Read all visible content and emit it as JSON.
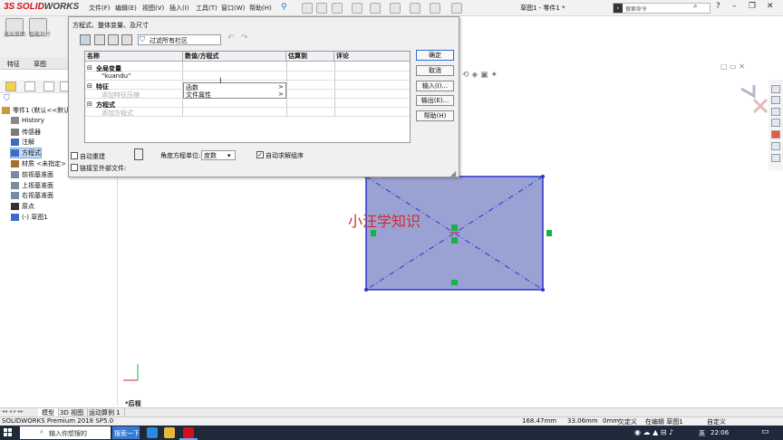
{
  "app": {
    "logo_ds": "3S",
    "logo_solid": "SOLID",
    "logo_works": "WORKS",
    "document_title": "草图1 - 零件1 *",
    "search_placeholder": "搜索命令"
  },
  "menu": [
    "文件(F)",
    "编辑(E)",
    "视图(V)",
    "插入(I)",
    "工具(T)",
    "窗口(W)",
    "帮助(H)"
  ],
  "command_manager": {
    "exit_sketch": "退出草图",
    "smart_dimension": "智能尺寸",
    "tabs": [
      "特征",
      "草图"
    ]
  },
  "feature_tree": {
    "items": [
      {
        "label": "零件1 (默认<<默认>",
        "level": 0,
        "icon": "part-icon",
        "color": "#c89a3c"
      },
      {
        "label": "History",
        "level": 1,
        "icon": "history-icon",
        "color": "#8a8a8a"
      },
      {
        "label": "传感器",
        "level": 1,
        "icon": "sensor-icon",
        "color": "#7a7a7a"
      },
      {
        "label": "注解",
        "level": 1,
        "icon": "annotation-icon",
        "color": "#3c6cc8"
      },
      {
        "label": "方程式",
        "level": 1,
        "icon": "equation-icon",
        "color": "#3c6cc8",
        "selected": true
      },
      {
        "label": "材质 <未指定>",
        "level": 1,
        "icon": "material-icon",
        "color": "#b06a2a"
      },
      {
        "label": "前视基准面",
        "level": 1,
        "icon": "plane-icon",
        "color": "#7a8aa0"
      },
      {
        "label": "上视基准面",
        "level": 1,
        "icon": "plane-icon",
        "color": "#7a8aa0"
      },
      {
        "label": "右视基准面",
        "level": 1,
        "icon": "plane-icon",
        "color": "#7a8aa0"
      },
      {
        "label": "原点",
        "level": 1,
        "icon": "origin-icon",
        "color": "#333333"
      },
      {
        "label": "(-) 草图1",
        "level": 1,
        "icon": "sketch-icon",
        "color": "#3c6cc8"
      }
    ]
  },
  "dialog": {
    "title": "方程式、整体变量、及尺寸",
    "filter_placeholder": "过滤所有栏区",
    "columns": [
      "名称",
      "数值/方程式",
      "估算到",
      "评论"
    ],
    "rows": [
      {
        "name": "全局变量",
        "type": "section"
      },
      {
        "name": "\"kuandu\"",
        "type": "item"
      },
      {
        "name": "特征",
        "type": "section",
        "value": "函数"
      },
      {
        "name": "添加特征压缩",
        "type": "hint"
      },
      {
        "name": "方程式",
        "type": "section"
      },
      {
        "name": "添加方程式",
        "type": "hint"
      }
    ],
    "submenu": [
      "函数",
      "文件属性"
    ],
    "buttons": [
      "确定",
      "取消",
      "输入(I)...",
      "输出(E)...",
      "帮助(H)"
    ],
    "auto_rebuild": "自动重建",
    "angle_unit_label": "角度方程单位:",
    "angle_unit_value": "度数",
    "auto_solve": "自动求解组序",
    "link_external": "链接至外部文件:"
  },
  "graphics": {
    "watermark": "小汪学知识",
    "viewport_label": "*后视",
    "colors": {
      "rect_fill": "#9aa2d4",
      "rect_stroke": "#2a35c8",
      "constraint": "#19b14a"
    }
  },
  "bottom_tabs": [
    "模型",
    "3D 视图",
    "运动算例 1"
  ],
  "status": {
    "product": "SOLIDWORKS Premium 2018 SP5.0",
    "x": "168.47mm",
    "y": "33.06mm",
    "z": "0mm",
    "state": "欠定义",
    "editing": "在编辑 草图1",
    "units": "自定义"
  },
  "taskbar": {
    "search": "输入你想搜的",
    "search_btn": "搜索一下",
    "time": "22:06",
    "lang": "英"
  }
}
